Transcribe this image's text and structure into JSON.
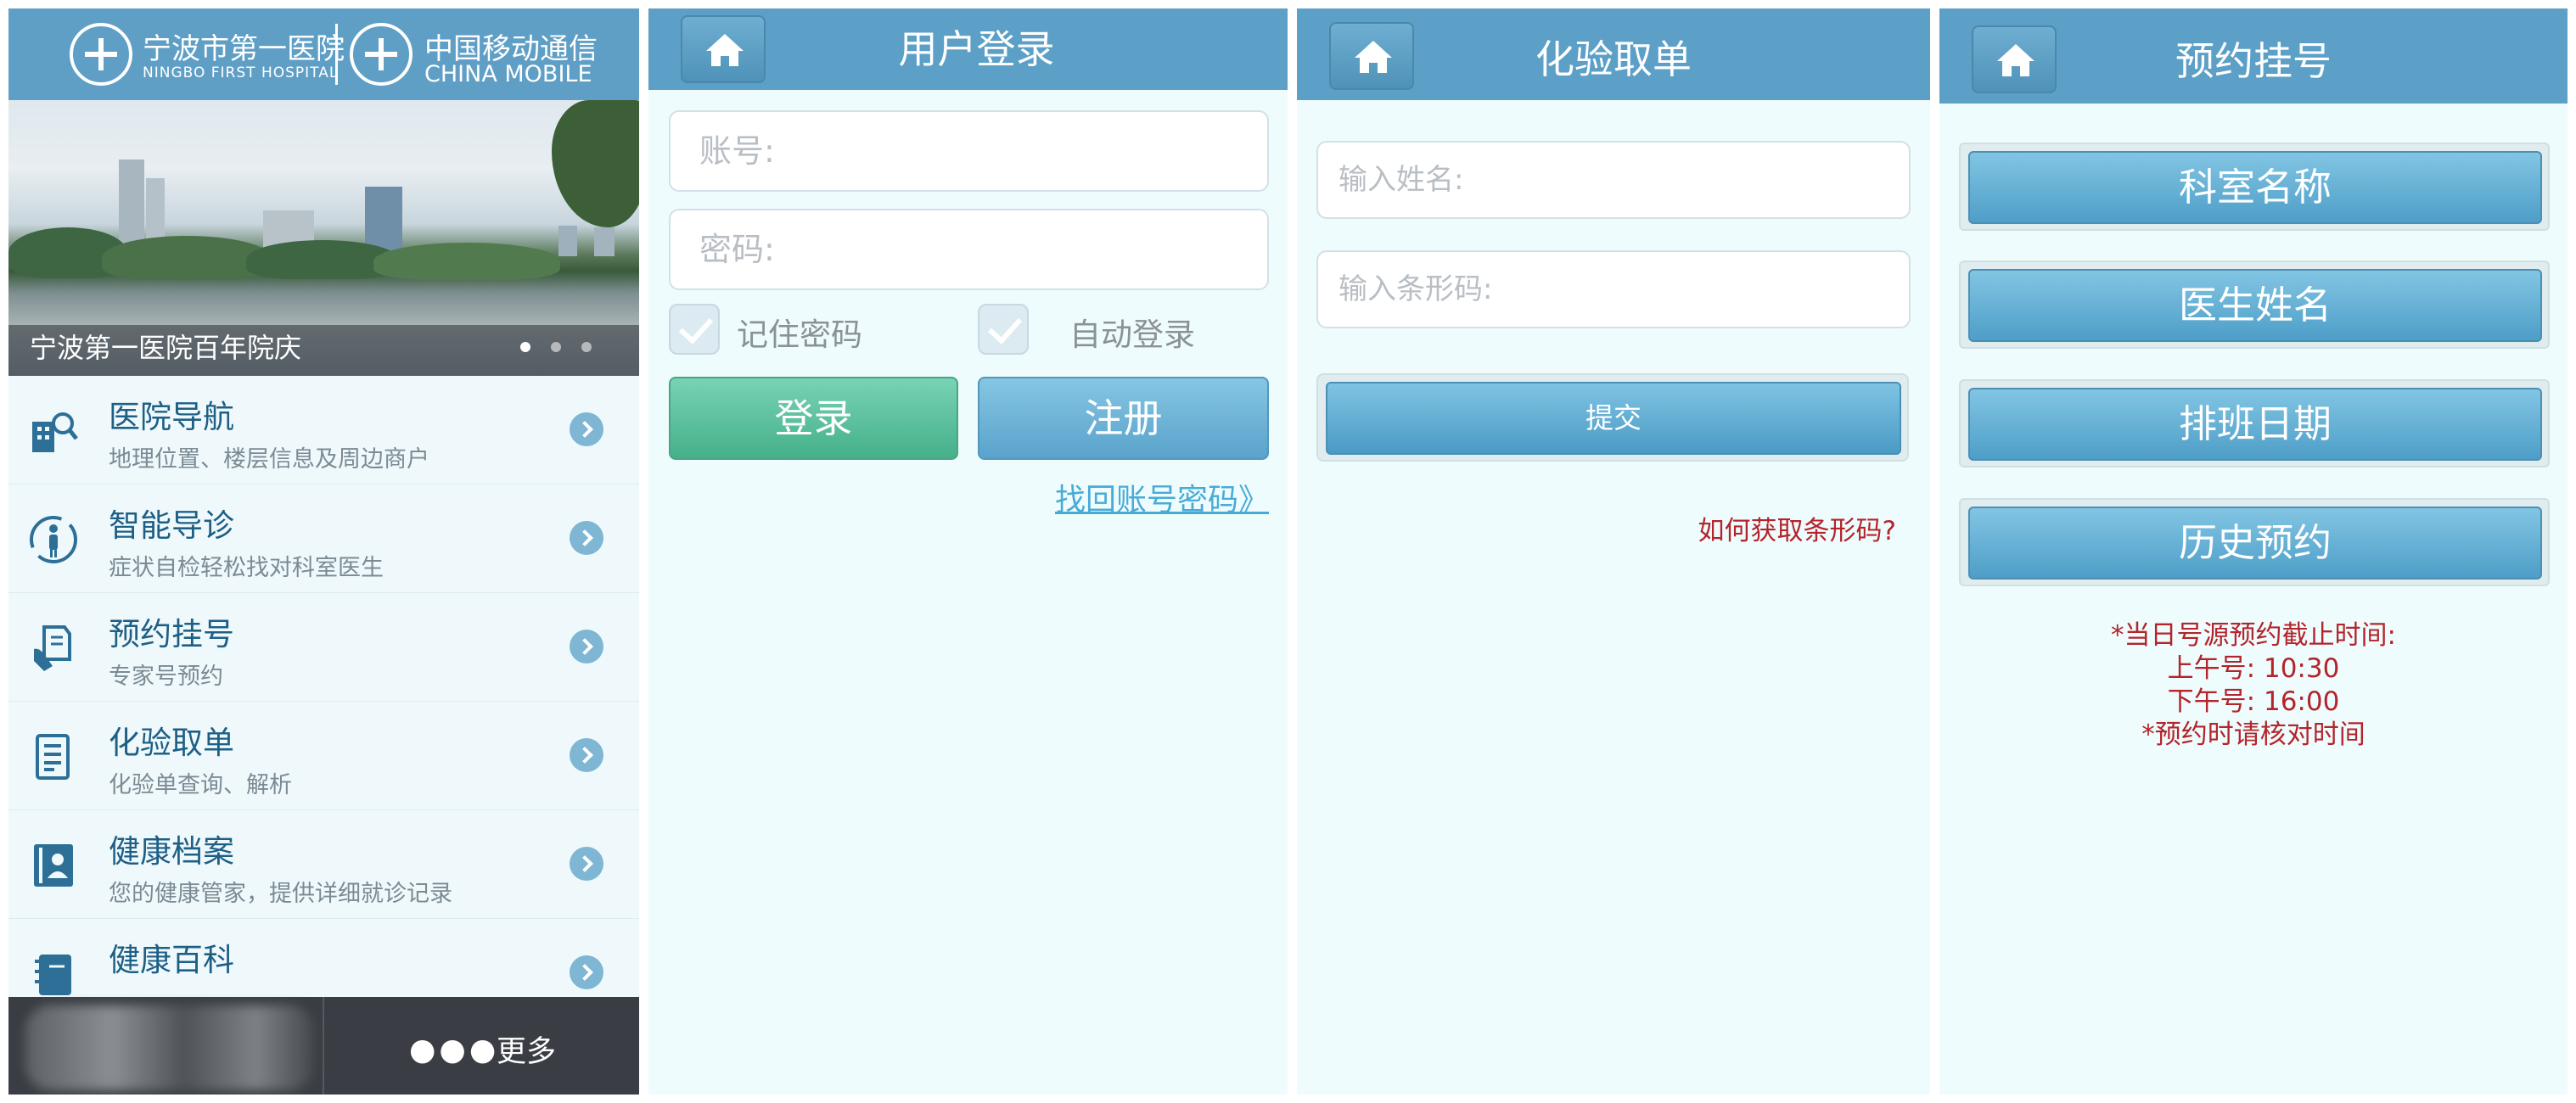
{
  "screen1": {
    "logo": {
      "hospital_cn": "宁波市第一医院",
      "hospital_en": "NINGBO FIRST HOSPITAL",
      "carrier_cn": "中国移动通信",
      "carrier_en": "CHINA MOBILE"
    },
    "banner": {
      "caption": "宁波第一医院百年院庆",
      "slides": 3,
      "active_slide": 1
    },
    "menu": [
      {
        "title": "医院导航",
        "subtitle": "地理位置、楼层信息及周边商户",
        "icon": "hospital-search-icon"
      },
      {
        "title": "智能导诊",
        "subtitle": "症状自检轻松找对科室医生",
        "icon": "body-icon"
      },
      {
        "title": "预约挂号",
        "subtitle": "专家号预约",
        "icon": "document-hand-icon"
      },
      {
        "title": "化验取单",
        "subtitle": "化验单查询、解析",
        "icon": "report-icon"
      },
      {
        "title": "健康档案",
        "subtitle": "您的健康管家，提供详细就诊记录",
        "icon": "profile-book-icon"
      },
      {
        "title": "健康百科",
        "subtitle": "",
        "icon": "notebook-icon"
      }
    ],
    "bottom_bar": {
      "more_label": "更多"
    }
  },
  "screen2": {
    "title": "用户登录",
    "account_placeholder": "账号:",
    "password_placeholder": "密码:",
    "remember_label": "记住密码",
    "autologin_label": "自动登录",
    "login_label": "登录",
    "register_label": "注册",
    "recover_link": "找回账号密码》"
  },
  "screen3": {
    "title": "化验取单",
    "name_placeholder": "输入姓名:",
    "barcode_placeholder": "输入条形码:",
    "submit_label": "提交",
    "help_link": "如何获取条形码?"
  },
  "screen4": {
    "title": "预约挂号",
    "buttons": [
      "科室名称",
      "医生姓名",
      "排班日期",
      "历史预约"
    ],
    "notice": {
      "line1": "*当日号源预约截止时间:",
      "line2": "上午号: 10:30",
      "line3": "下午号: 16:00",
      "line4": "*预约时请核对时间"
    }
  },
  "colors": {
    "header_blue": "#5c9fc7",
    "green_button": "#45b08a",
    "notice_red": "#b3242b",
    "link_blue": "#49abd8"
  }
}
